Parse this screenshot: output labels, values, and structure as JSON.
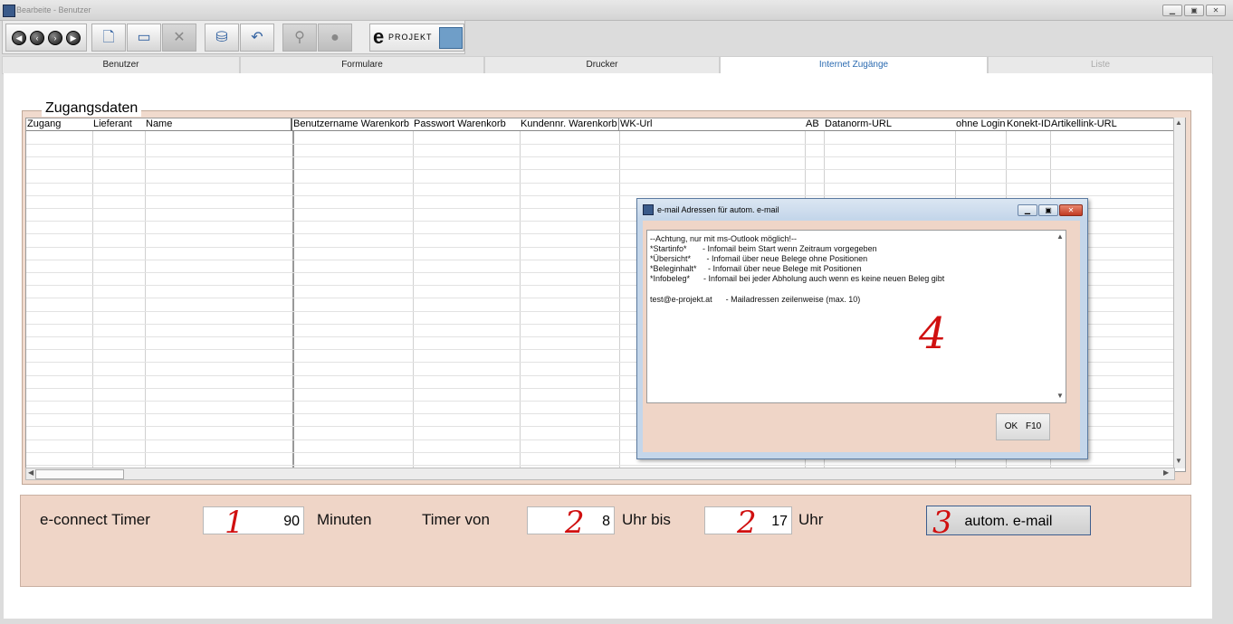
{
  "window": {
    "title": "Bearbeite - Benutzer"
  },
  "toolbar": {
    "logo_text": "PROJEKT"
  },
  "tabs": [
    {
      "label": "Benutzer"
    },
    {
      "label": "Formulare"
    },
    {
      "label": "Drucker"
    },
    {
      "label": "Internet Zugänge"
    },
    {
      "label": "Liste"
    }
  ],
  "section": {
    "title": "Zugangsdaten"
  },
  "grid": {
    "columns": [
      "Zugang",
      "Lieferant",
      "Name",
      "Benutzername Warenkorb",
      "Passwort Warenkorb",
      "Kundennr. Warenkorb",
      "WK-Url",
      "AB",
      "Datanorm-URL",
      "ohne Login",
      "Konekt-ID",
      "Artikellink-URL"
    ]
  },
  "timer": {
    "label": "e-connect Timer",
    "minutes_value": "90",
    "minutes_unit": "Minuten",
    "from_label": "Timer von",
    "from_value": "8",
    "to_label": "Uhr bis",
    "to_value": "17",
    "end_label": "Uhr",
    "mail_button": "autom. e-mail"
  },
  "annotations": {
    "n1": "1",
    "n2a": "2",
    "n2b": "2",
    "n3": "3",
    "n4": "4"
  },
  "dialog": {
    "title": "e-mail Adressen für autom. e-mail",
    "lines": [
      "--Achtung, nur mit ms-Outlook möglich!--",
      "*Startinfo*       - Infomail beim Start wenn Zeitraum vorgegeben",
      "*Übersicht*       - Infomail über neue Belege ohne Positionen",
      "*Beleginhalt*     - Infomail über neue Belege mit Positionen",
      "*Infobeleg*      - Infomail bei jeder Abholung auch wenn es keine neuen Beleg gibt",
      "",
      "test@e-projekt.at      - Mailadressen zeilenweise (max. 10)"
    ],
    "ok_label": "OK",
    "ok_key": "F10"
  }
}
